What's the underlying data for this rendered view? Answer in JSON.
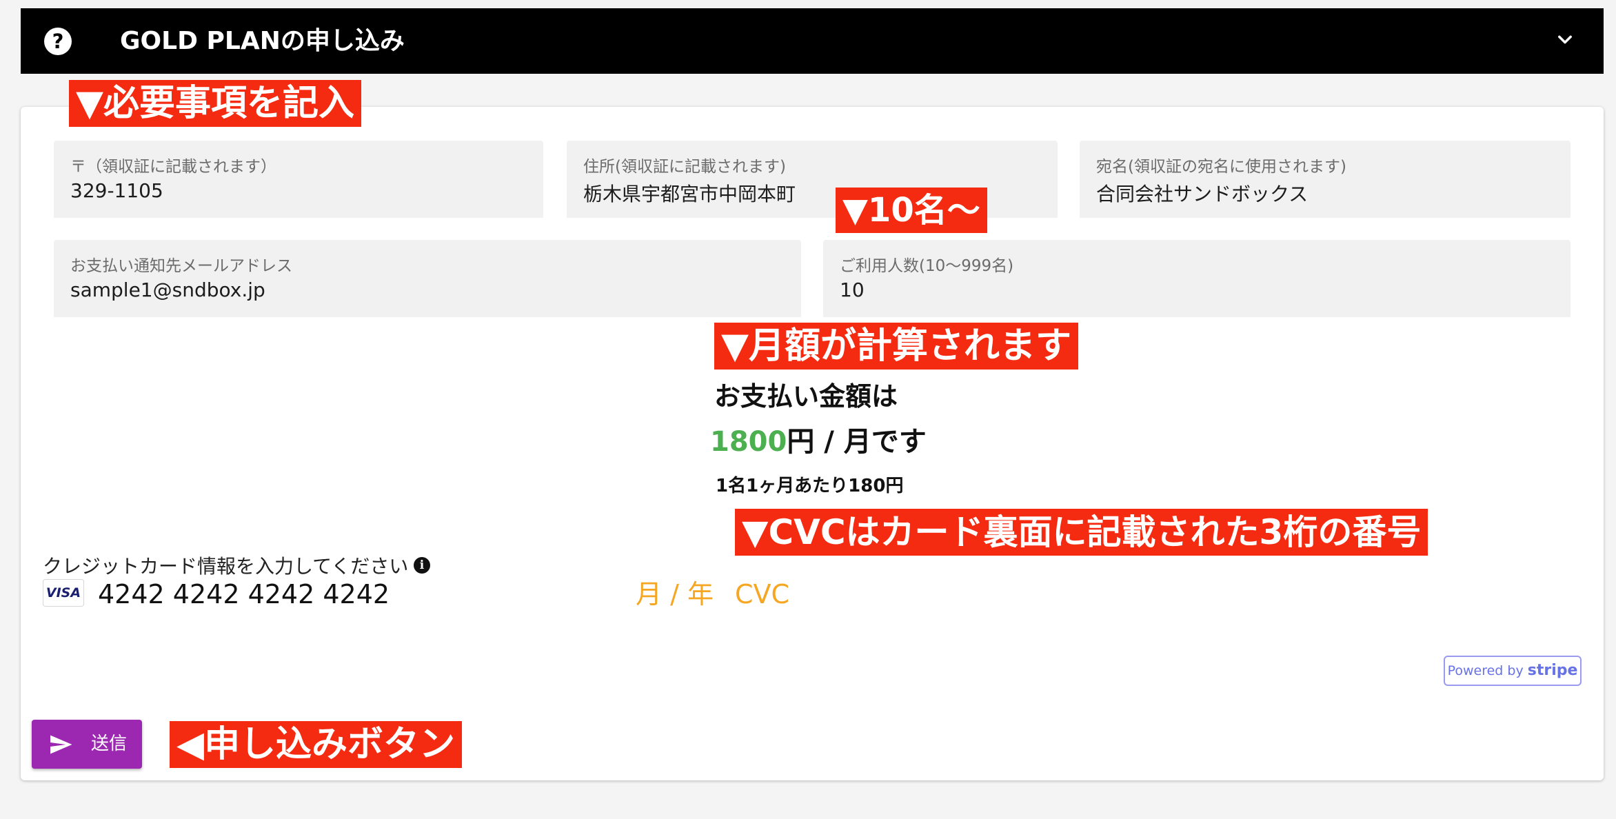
{
  "header": {
    "help_icon": "question-circle-icon",
    "title": "GOLD PLANの申し込み",
    "expand_icon": "chevron-down-icon"
  },
  "annotations": {
    "fill_required": "▼必要事項を記入",
    "ten_people": "▼10名〜",
    "monthly_calc": "▼月額が計算されます",
    "cvc_note": "▼CVCはカード裏面に記載された3桁の番号",
    "submit_note": "◀申し込みボタン",
    "color": "#f42a11"
  },
  "form": {
    "postal": {
      "label": "〒（領収証に記載されます）",
      "value": "329-1105"
    },
    "address": {
      "label": "住所(領収証に記載されます)",
      "value": "栃木県宇都宮市中岡本町"
    },
    "recipient": {
      "label": "宛名(領収証の宛名に使用されます)",
      "value": "合同会社サンドボックス"
    },
    "email": {
      "label": "お支払い通知先メールアドレス",
      "value": "sample1@sndbox.jp"
    },
    "users": {
      "label": "ご利用人数(10〜999名)",
      "value": "10"
    }
  },
  "summary": {
    "line1": "お支払い金額は",
    "amount": "1800",
    "amount_suffix": "円 / 月です",
    "per_person": "1名1ヶ月あたり180円",
    "amount_color": "#4caf50"
  },
  "credit_card": {
    "label": "クレジットカード情報を入力してください",
    "info_icon": "info-circle-icon",
    "brand": "VISA",
    "number": "4242 4242 4242 4242",
    "expiry_placeholder": "月 / 年",
    "cvc_placeholder": "CVC",
    "placeholder_color": "#f5a623"
  },
  "stripe_badge": {
    "powered_by": "Powered by",
    "brand": "stripe"
  },
  "submit": {
    "label": "送信",
    "icon": "send-icon",
    "color": "#9c27b0"
  }
}
